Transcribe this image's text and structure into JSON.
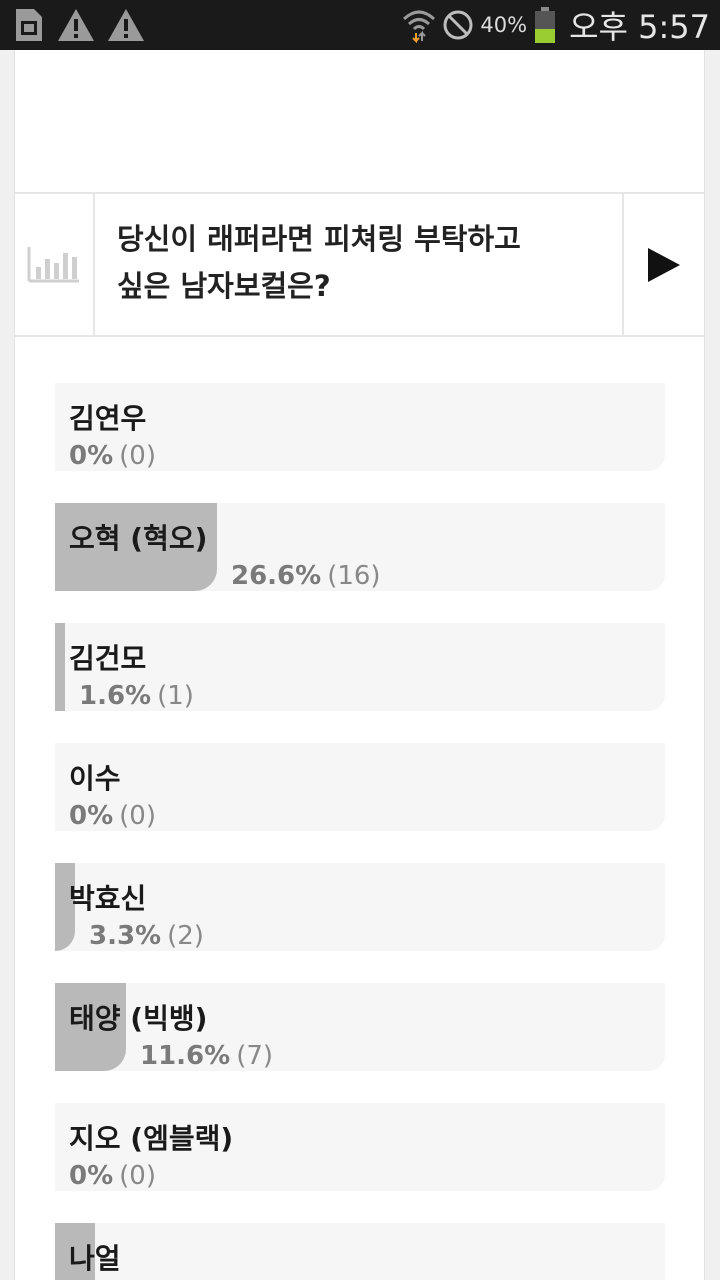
{
  "status_bar": {
    "battery_percent": "40%",
    "clock": "오후 5:57",
    "icons": [
      "sim-card-icon",
      "warning-icon",
      "warning-icon",
      "wifi-icon",
      "no-sound-icon",
      "battery-icon"
    ]
  },
  "poll": {
    "title_line1": "당신이 래퍼라면 피쳐링 부탁하고",
    "title_line2": "싶은 남자보컬은?",
    "options": [
      {
        "name": "김연우",
        "percent": "0%",
        "count": "(0)",
        "fraction": 0.0
      },
      {
        "name": "오혁 (혁오)",
        "percent": "26.6%",
        "count": "(16)",
        "fraction": 0.266
      },
      {
        "name": "김건모",
        "percent": "1.6%",
        "count": "(1)",
        "fraction": 0.016
      },
      {
        "name": "이수",
        "percent": "0%",
        "count": "(0)",
        "fraction": 0.0
      },
      {
        "name": "박효신",
        "percent": "3.3%",
        "count": "(2)",
        "fraction": 0.033
      },
      {
        "name": "태양 (빅뱅)",
        "percent": "11.6%",
        "count": "(7)",
        "fraction": 0.116
      },
      {
        "name": "지오 (엠블랙)",
        "percent": "0%",
        "count": "(0)",
        "fraction": 0.0
      },
      {
        "name": "나얼",
        "percent": "",
        "count": "",
        "fraction": 0.066
      }
    ]
  },
  "colors": {
    "bar_fill": "#b9b9b9",
    "option_bg": "#f6f6f6",
    "status_bar_bg": "#1a1a1a",
    "battery_green": "#9acd32"
  }
}
